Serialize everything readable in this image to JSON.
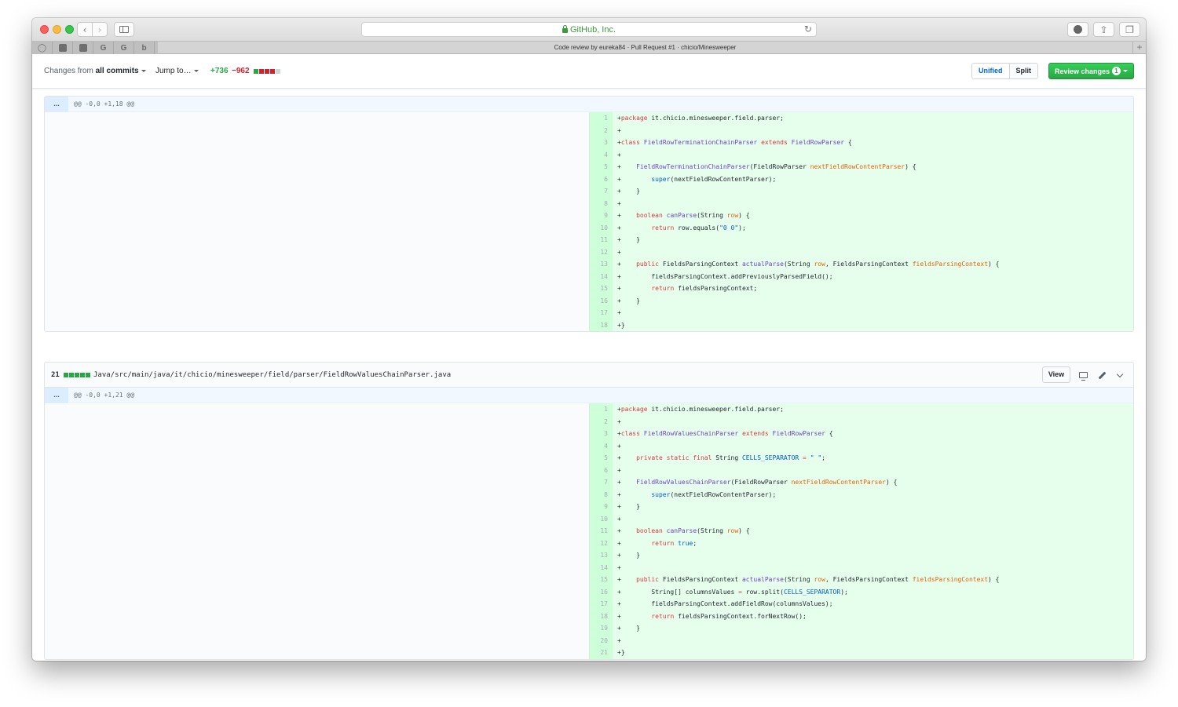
{
  "browser": {
    "address": "GitHub, Inc.",
    "tab_title": "Code review by eureka84 · Pull Request #1 · chicio/Minesweeper",
    "favorites": [
      "github-icon",
      "square-icon",
      "square-icon",
      "google-icon",
      "google-icon",
      "bing-icon"
    ],
    "back_glyph": "‹",
    "forward_glyph": "›",
    "reload_glyph": "↻",
    "share_glyph": "⇪",
    "tabs_glyph": "❐",
    "new_tab_glyph": "+"
  },
  "toolbar": {
    "changes_prefix": "Changes from",
    "changes_value": "all commits",
    "jump_to": "Jump to…",
    "additions": "+736",
    "deletions": "−962",
    "diffstat_colors": [
      "#28a745",
      "#cb2431",
      "#cb2431",
      "#cb2431",
      "#d1d5da"
    ],
    "view_unified": "Unified",
    "view_split": "Split",
    "review_label": "Review changes",
    "review_count": "1"
  },
  "colors": {
    "added_bg": "#e6ffed",
    "added_num_bg": "#cdffd8",
    "green": "#28a745",
    "red": "#cb2431",
    "blue": "#0366d6"
  },
  "files": [
    {
      "hunk_expand": "...",
      "hunk": "@@ -0,0 +1,18 @@",
      "lines": [
        [
          [
            "",
            "+"
          ],
          [
            "kw",
            "package"
          ],
          [
            "",
            " it.chicio.minesweeper.field.parser;"
          ]
        ],
        [
          [
            "",
            "+"
          ]
        ],
        [
          [
            "",
            "+"
          ],
          [
            "kw",
            "class"
          ],
          [
            "",
            " "
          ],
          [
            "ty",
            "FieldRowTerminationChainParser"
          ],
          [
            "",
            " "
          ],
          [
            "kw",
            "extends"
          ],
          [
            "",
            " "
          ],
          [
            "ty",
            "FieldRowParser"
          ],
          [
            "",
            " {"
          ]
        ],
        [
          [
            "",
            "+"
          ]
        ],
        [
          [
            "",
            "+    "
          ],
          [
            "nm",
            "FieldRowTerminationChainParser"
          ],
          [
            "",
            "(FieldRowParser "
          ],
          [
            "pa",
            "nextFieldRowContentParser"
          ],
          [
            "",
            ") {"
          ]
        ],
        [
          [
            "",
            "+        "
          ],
          [
            "co",
            "super"
          ],
          [
            "",
            "(nextFieldRowContentParser);"
          ]
        ],
        [
          [
            "",
            "+    }"
          ]
        ],
        [
          [
            "",
            "+"
          ]
        ],
        [
          [
            "",
            "+    "
          ],
          [
            "kw",
            "boolean"
          ],
          [
            "",
            " "
          ],
          [
            "nm",
            "canParse"
          ],
          [
            "",
            "(String "
          ],
          [
            "pa",
            "row"
          ],
          [
            "",
            ") {"
          ]
        ],
        [
          [
            "",
            "+        "
          ],
          [
            "kw",
            "return"
          ],
          [
            "",
            " row.equals("
          ],
          [
            "co",
            "\"0 0\""
          ],
          [
            "",
            ");"
          ]
        ],
        [
          [
            "",
            "+    }"
          ]
        ],
        [
          [
            "",
            "+"
          ]
        ],
        [
          [
            "",
            "+    "
          ],
          [
            "kw",
            "public"
          ],
          [
            "",
            " FieldsParsingContext "
          ],
          [
            "nm",
            "actualParse"
          ],
          [
            "",
            "(String "
          ],
          [
            "pa",
            "row"
          ],
          [
            "",
            ", FieldsParsingContext "
          ],
          [
            "pa",
            "fieldsParsingContext"
          ],
          [
            "",
            ") {"
          ]
        ],
        [
          [
            "",
            "+        fieldsParsingContext.addPreviouslyParsedField();"
          ]
        ],
        [
          [
            "",
            "+        "
          ],
          [
            "kw",
            "return"
          ],
          [
            "",
            " fieldsParsingContext;"
          ]
        ],
        [
          [
            "",
            "+    }"
          ]
        ],
        [
          [
            "",
            "+"
          ]
        ],
        [
          [
            "",
            "+}"
          ]
        ]
      ]
    },
    {
      "count": "21",
      "diffstat_colors": [
        "#28a745",
        "#28a745",
        "#28a745",
        "#28a745",
        "#28a745"
      ],
      "path": "Java/src/main/java/it/chicio/minesweeper/field/parser/FieldRowValuesChainParser.java",
      "view_label": "View",
      "hunk_expand": "...",
      "hunk": "@@ -0,0 +1,21 @@",
      "lines": [
        [
          [
            "",
            "+"
          ],
          [
            "kw",
            "package"
          ],
          [
            "",
            " it.chicio.minesweeper.field.parser;"
          ]
        ],
        [
          [
            "",
            "+"
          ]
        ],
        [
          [
            "",
            "+"
          ],
          [
            "kw",
            "class"
          ],
          [
            "",
            " "
          ],
          [
            "ty",
            "FieldRowValuesChainParser"
          ],
          [
            "",
            " "
          ],
          [
            "kw",
            "extends"
          ],
          [
            "",
            " "
          ],
          [
            "ty",
            "FieldRowParser"
          ],
          [
            "",
            " {"
          ]
        ],
        [
          [
            "",
            "+"
          ]
        ],
        [
          [
            "",
            "+    "
          ],
          [
            "kw",
            "private static final"
          ],
          [
            "",
            " String "
          ],
          [
            "co",
            "CELLS_SEPARATOR"
          ],
          [
            "",
            " "
          ],
          [
            "kw",
            "="
          ],
          [
            "",
            " "
          ],
          [
            "co",
            "\" \""
          ],
          [
            "",
            ";"
          ]
        ],
        [
          [
            "",
            "+"
          ]
        ],
        [
          [
            "",
            "+    "
          ],
          [
            "nm",
            "FieldRowValuesChainParser"
          ],
          [
            "",
            "(FieldRowParser "
          ],
          [
            "pa",
            "nextFieldRowContentParser"
          ],
          [
            "",
            ") {"
          ]
        ],
        [
          [
            "",
            "+        "
          ],
          [
            "co",
            "super"
          ],
          [
            "",
            "(nextFieldRowContentParser);"
          ]
        ],
        [
          [
            "",
            "+    }"
          ]
        ],
        [
          [
            "",
            "+"
          ]
        ],
        [
          [
            "",
            "+    "
          ],
          [
            "kw",
            "boolean"
          ],
          [
            "",
            " "
          ],
          [
            "nm",
            "canParse"
          ],
          [
            "",
            "(String "
          ],
          [
            "pa",
            "row"
          ],
          [
            "",
            ") {"
          ]
        ],
        [
          [
            "",
            "+        "
          ],
          [
            "kw",
            "return"
          ],
          [
            "",
            " "
          ],
          [
            "co",
            "true"
          ],
          [
            "",
            ";"
          ]
        ],
        [
          [
            "",
            "+    }"
          ]
        ],
        [
          [
            "",
            "+"
          ]
        ],
        [
          [
            "",
            "+    "
          ],
          [
            "kw",
            "public"
          ],
          [
            "",
            " FieldsParsingContext "
          ],
          [
            "nm",
            "actualParse"
          ],
          [
            "",
            "(String "
          ],
          [
            "pa",
            "row"
          ],
          [
            "",
            ", FieldsParsingContext "
          ],
          [
            "pa",
            "fieldsParsingContext"
          ],
          [
            "",
            ") {"
          ]
        ],
        [
          [
            "",
            "+        String[] columnsValues "
          ],
          [
            "kw",
            "="
          ],
          [
            "",
            " row.split("
          ],
          [
            "co",
            "CELLS_SEPARATOR"
          ],
          [
            "",
            ");"
          ]
        ],
        [
          [
            "",
            "+        fieldsParsingContext.addFieldRow(columnsValues);"
          ]
        ],
        [
          [
            "",
            "+        "
          ],
          [
            "kw",
            "return"
          ],
          [
            "",
            " fieldsParsingContext.forNextRow();"
          ]
        ],
        [
          [
            "",
            "+    }"
          ]
        ],
        [
          [
            "",
            "+"
          ]
        ],
        [
          [
            "",
            "+}"
          ]
        ]
      ]
    }
  ]
}
